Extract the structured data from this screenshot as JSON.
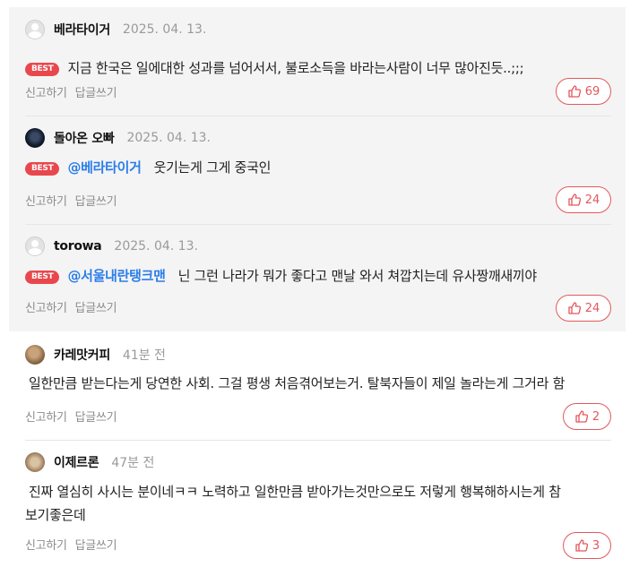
{
  "actions": {
    "reply": "신고하기",
    "write": "답글쓰기"
  },
  "best_label": "BEST",
  "comments": [
    {
      "nick": "베라타이거",
      "time": "2025. 04. 13.",
      "mention": "",
      "text": "지금 한국은 일에대한 성과를 넘어서서, 불로소득을 바라는사람이 너무 많아진듯..;;;",
      "likes": "69",
      "avatar": "grey-default"
    },
    {
      "nick": "돌아온 오빠",
      "time": "2025. 04. 13.",
      "mention": "@베라타이거",
      "text": "웃기는게 그게 중국인",
      "likes": "24",
      "avatar": "dark-photo"
    },
    {
      "nick": "torowa",
      "time": "2025. 04. 13.",
      "mention": "@서울내란탱크맨",
      "text": "닌 그런 나라가 뭐가 좋다고 맨날 와서 쳐깝치는데 유사짱깨새끼야",
      "likes": "24",
      "avatar": "grey-default"
    },
    {
      "nick": "카레맛커피",
      "time": "41분 전",
      "text": "일한만큼 받는다는게 당연한 사회. 그걸 평생 처음겪어보는거. 탈북자들이 제일 놀라는게 그거라 함",
      "likes": "2",
      "avatar": "brown-photo"
    },
    {
      "nick": "이제르론",
      "time": "47분 전",
      "text_line1": "진짜 열심히 사시는 분이네ㅋㅋ 노력하고 일한만큼 받아가는것만으로도 저렇게 행복해하시는게 참",
      "text_line2": "보기좋은데",
      "likes": "3",
      "avatar": "photo"
    }
  ],
  "colors": {
    "best_badge": "#e8484d",
    "mention": "#2b7de9",
    "like_border": "#e2585c",
    "best_bg": "#f4f4f4"
  }
}
